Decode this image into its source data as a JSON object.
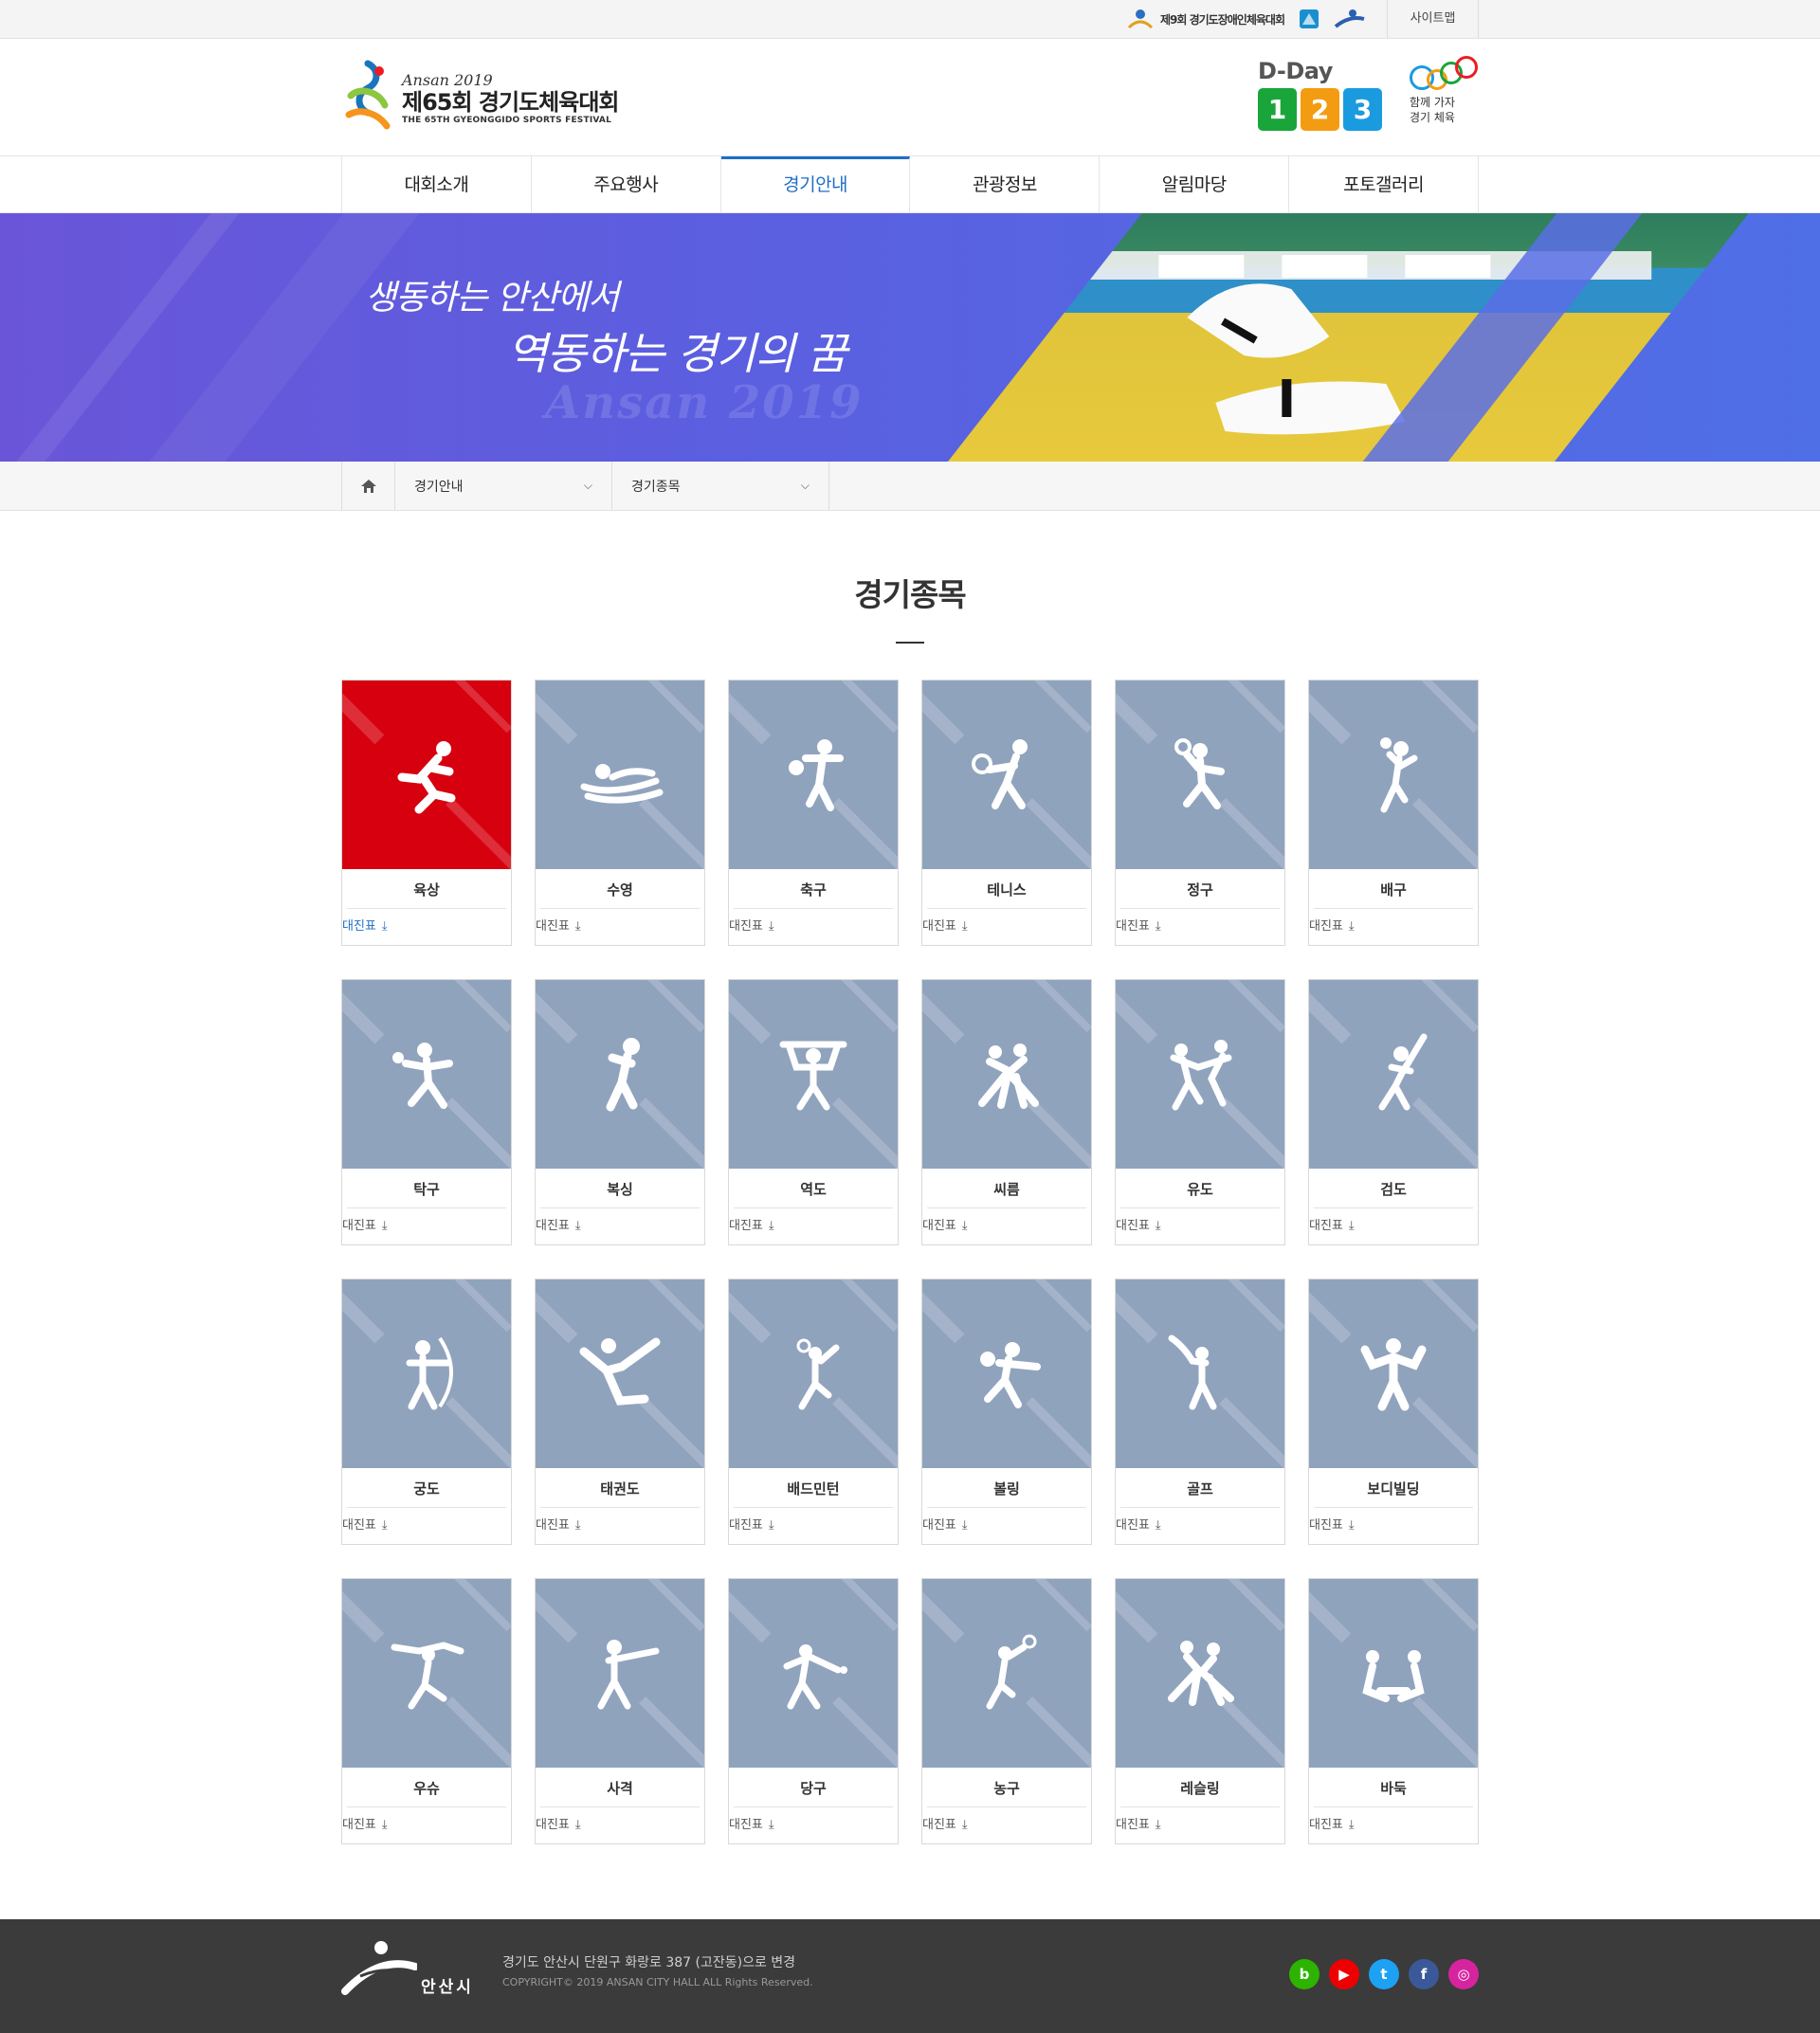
{
  "util": {
    "partner_logo_text": "제9회 경기도장애인체육대회",
    "sitemap_label": "사이트맵"
  },
  "header": {
    "brand_sub": "Ansan 2019",
    "brand_main": "제65회 경기도체육대회",
    "brand_en": "THE 65TH GYEONGGIDO SPORTS FESTIVAL",
    "dday_label": "D-Day",
    "dday_digits": [
      "1",
      "2",
      "3"
    ],
    "digit_colors": [
      "#1aa53a",
      "#f39c12",
      "#1a9be0"
    ],
    "go_slogan_1": "함께 가자",
    "go_slogan_2": "경기 체육"
  },
  "nav": [
    {
      "label": "대회소개",
      "active": false
    },
    {
      "label": "주요행사",
      "active": false
    },
    {
      "label": "경기안내",
      "active": true
    },
    {
      "label": "관광정보",
      "active": false
    },
    {
      "label": "알림마당",
      "active": false
    },
    {
      "label": "포토갤러리",
      "active": false
    }
  ],
  "banner": {
    "slogan_1": "생동하는 안산에서",
    "slogan_2": "역동하는 경기의 꿈",
    "watermark": "Ansan 2019"
  },
  "breadcrumb": {
    "home_icon": "home-icon",
    "level1": "경기안내",
    "level2": "경기종목"
  },
  "page_title": "경기종목",
  "sports": [
    {
      "name": "육상",
      "dl": "대진표",
      "icon": "running-icon",
      "active": true
    },
    {
      "name": "수영",
      "dl": "대진표",
      "icon": "swimming-icon"
    },
    {
      "name": "축구",
      "dl": "대진표",
      "icon": "soccer-icon"
    },
    {
      "name": "테니스",
      "dl": "대진표",
      "icon": "tennis-icon"
    },
    {
      "name": "정구",
      "dl": "대진표",
      "icon": "soft-tennis-icon"
    },
    {
      "name": "배구",
      "dl": "대진표",
      "icon": "volleyball-icon"
    },
    {
      "name": "탁구",
      "dl": "대진표",
      "icon": "table-tennis-icon"
    },
    {
      "name": "복싱",
      "dl": "대진표",
      "icon": "boxing-icon"
    },
    {
      "name": "역도",
      "dl": "대진표",
      "icon": "weightlifting-icon"
    },
    {
      "name": "씨름",
      "dl": "대진표",
      "icon": "ssireum-icon"
    },
    {
      "name": "유도",
      "dl": "대진표",
      "icon": "judo-icon"
    },
    {
      "name": "검도",
      "dl": "대진표",
      "icon": "kendo-icon"
    },
    {
      "name": "궁도",
      "dl": "대진표",
      "icon": "archery-icon"
    },
    {
      "name": "태권도",
      "dl": "대진표",
      "icon": "taekwondo-icon"
    },
    {
      "name": "배드민턴",
      "dl": "대진표",
      "icon": "badminton-icon"
    },
    {
      "name": "볼링",
      "dl": "대진표",
      "icon": "bowling-icon"
    },
    {
      "name": "골프",
      "dl": "대진표",
      "icon": "golf-icon"
    },
    {
      "name": "보디빌딩",
      "dl": "대진표",
      "icon": "bodybuilding-icon"
    },
    {
      "name": "우슈",
      "dl": "대진표",
      "icon": "wushu-icon"
    },
    {
      "name": "사격",
      "dl": "대진표",
      "icon": "shooting-icon"
    },
    {
      "name": "당구",
      "dl": "대진표",
      "icon": "billiards-icon"
    },
    {
      "name": "농구",
      "dl": "대진표",
      "icon": "basketball-icon"
    },
    {
      "name": "레슬링",
      "dl": "대진표",
      "icon": "wrestling-icon"
    },
    {
      "name": "바둑",
      "dl": "대진표",
      "icon": "baduk-icon"
    }
  ],
  "footer": {
    "logo_name": "안산시",
    "address": "경기도 안산시 단원구 화랑로 387 (고잔동)으로 변경",
    "copyright": "COPYRIGHT© 2019 ANSAN CITY HALL ALL Rights Reserved.",
    "sns": [
      {
        "name": "blog-icon",
        "glyph": "b",
        "color": "#2db400"
      },
      {
        "name": "youtube-icon",
        "glyph": "▶",
        "color": "#e00"
      },
      {
        "name": "twitter-icon",
        "glyph": "t",
        "color": "#1da1f2"
      },
      {
        "name": "facebook-icon",
        "glyph": "f",
        "color": "#3b5998"
      },
      {
        "name": "instagram-icon",
        "glyph": "◎",
        "color": "#d6249f"
      }
    ]
  }
}
